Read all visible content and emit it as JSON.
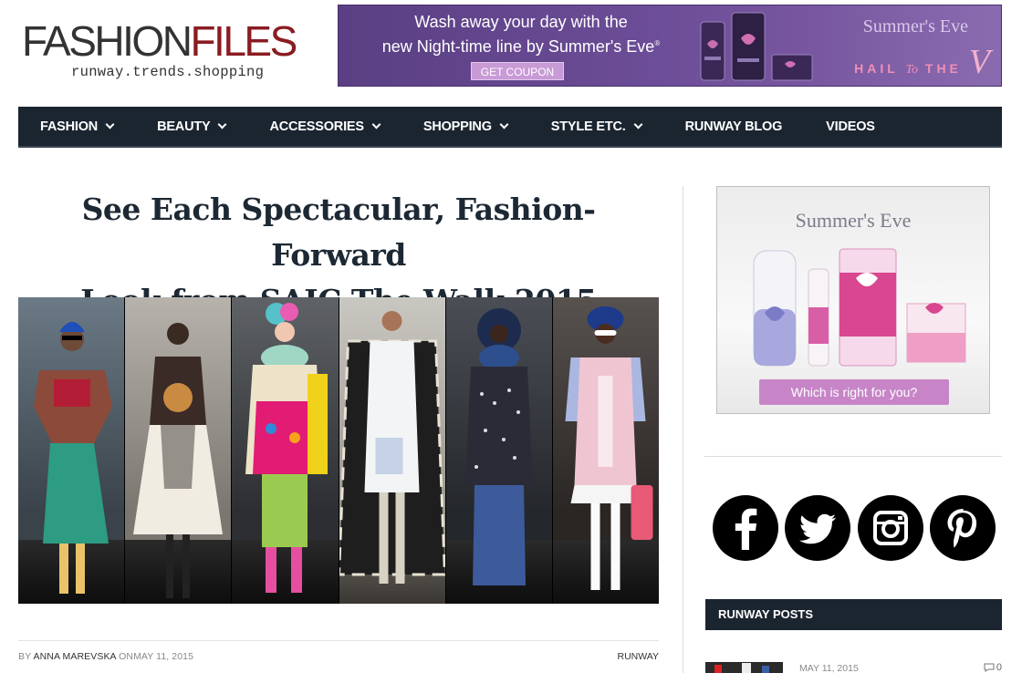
{
  "header": {
    "logo_part1": "FASHION",
    "logo_part2": "FILES",
    "tagline": "runway.trends.shopping"
  },
  "banner_ad": {
    "line1": "Wash away your day with the",
    "line2": "new Night-time line by Summer's Eve",
    "button": "GET COUPON",
    "brand": "Summer's Eve",
    "slogan_prefix": "HAIL",
    "slogan_to": "To",
    "slogan_the": "THE",
    "slogan_v": "V"
  },
  "nav": {
    "items": [
      {
        "label": "FASHION",
        "dropdown": true
      },
      {
        "label": "BEAUTY",
        "dropdown": true
      },
      {
        "label": "ACCESSORIES",
        "dropdown": true
      },
      {
        "label": "SHOPPING",
        "dropdown": true
      },
      {
        "label": "STYLE ETC.",
        "dropdown": true
      },
      {
        "label": "RUNWAY BLOG",
        "dropdown": false
      },
      {
        "label": "VIDEOS",
        "dropdown": false
      }
    ]
  },
  "article": {
    "title_line1": "See Each Spectacular, Fashion-Forward",
    "title_line2": "Look from SAIC The Walk 2015",
    "by": "BY",
    "author": "ANNA MAREVSKA",
    "on": "ON",
    "date": "MAY 11, 2015",
    "category": "RUNWAY"
  },
  "sidebar": {
    "ad_brand": "Summer's Eve",
    "ad_button": "Which is right for you?",
    "social": [
      "facebook",
      "twitter",
      "instagram",
      "pinterest"
    ],
    "section_title": "RUNWAY POSTS",
    "post": {
      "date": "MAY 11, 2015",
      "comments": "0"
    }
  },
  "colors": {
    "nav_bg": "#1b2530",
    "logo_accent": "#8a1c22",
    "ad_purple": "#6b4c96",
    "ad_button_pink": "#c785c8"
  }
}
